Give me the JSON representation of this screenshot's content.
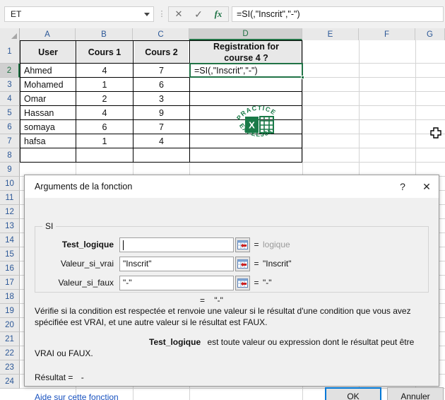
{
  "formula_bar": {
    "name_box_value": "ET",
    "name_box_dropdown_icon": "chevron-down-icon",
    "cancel_icon": "close-icon",
    "enter_icon": "check-icon",
    "insert_function_icon": "fx-icon",
    "formula_value": "=SI(,\"Inscrit\",\"-\")"
  },
  "grid": {
    "column_headers": [
      "A",
      "B",
      "C",
      "D",
      "E",
      "F",
      "G"
    ],
    "selected_column": "D",
    "row_headers": [
      "1",
      "2",
      "3",
      "4",
      "5",
      "6",
      "7",
      "8",
      "9",
      "10",
      "11",
      "12",
      "13",
      "14",
      "15",
      "16",
      "17",
      "18",
      "19",
      "20",
      "21",
      "22",
      "23",
      "24"
    ],
    "selected_row": "2",
    "table_headers": {
      "a": "User",
      "b": "Cours 1",
      "c": "Cours 2",
      "d_line1": "Registration for",
      "d_line2": "course 4 ?"
    },
    "rows": [
      {
        "user": "Ahmed",
        "cours1": "4",
        "cours2": "7",
        "reg": "=SI(,\"Inscrit\",\"-\")"
      },
      {
        "user": "Mohamed",
        "cours1": "1",
        "cours2": "6",
        "reg": ""
      },
      {
        "user": "Omar",
        "cours1": "2",
        "cours2": "3",
        "reg": ""
      },
      {
        "user": "Hassan",
        "cours1": "4",
        "cours2": "9",
        "reg": ""
      },
      {
        "user": "somaya",
        "cours1": "6",
        "cours2": "7",
        "reg": ""
      },
      {
        "user": "hafsa",
        "cours1": "1",
        "cours2": "4",
        "reg": ""
      }
    ],
    "watermark": {
      "top_text": "PRACTICE",
      "bottom_text": "EXCEL365",
      "letter": "X",
      "color": "#1a7a48"
    },
    "cursor_icon": "excel-cross-cursor"
  },
  "dialog": {
    "title": "Arguments de la fonction",
    "help_icon": "question-mark-icon",
    "close_icon": "close-icon",
    "function_name": "SI",
    "args": [
      {
        "label": "Test_logique",
        "value": "",
        "bold": true,
        "eq": "=",
        "result": "logique",
        "muted": true,
        "range_icon": "range-select-icon"
      },
      {
        "label": "Valeur_si_vrai",
        "value": "\"Inscrit\"",
        "bold": false,
        "eq": "=",
        "result": "\"Inscrit\"",
        "muted": false,
        "range_icon": "range-select-icon"
      },
      {
        "label": "Valeur_si_faux",
        "value": "\"-\"",
        "bold": false,
        "eq": "=",
        "result": "\"-\"",
        "muted": false,
        "range_icon": "range-select-icon"
      }
    ],
    "final_eq_symbol": "=",
    "final_eq_value": "\"-\"",
    "description": "Vérifie si la condition est respectée et renvoie une valeur si le résultat d'une condition que vous avez spécifiée est VRAI, et une autre valeur si le résultat est FAUX.",
    "arg_help_name": "Test_logique",
    "arg_help_text": "est toute valeur ou expression dont le résultat peut être VRAI ou FAUX.",
    "result_label": "Résultat =",
    "result_value": "-",
    "help_link": "Aide sur cette fonction",
    "ok_label": "OK",
    "cancel_label": "Annuler"
  },
  "colors": {
    "excel_green": "#217346",
    "header_blue": "#2b5797",
    "focus_blue": "#0078d7",
    "link_blue": "#1a53c0"
  }
}
